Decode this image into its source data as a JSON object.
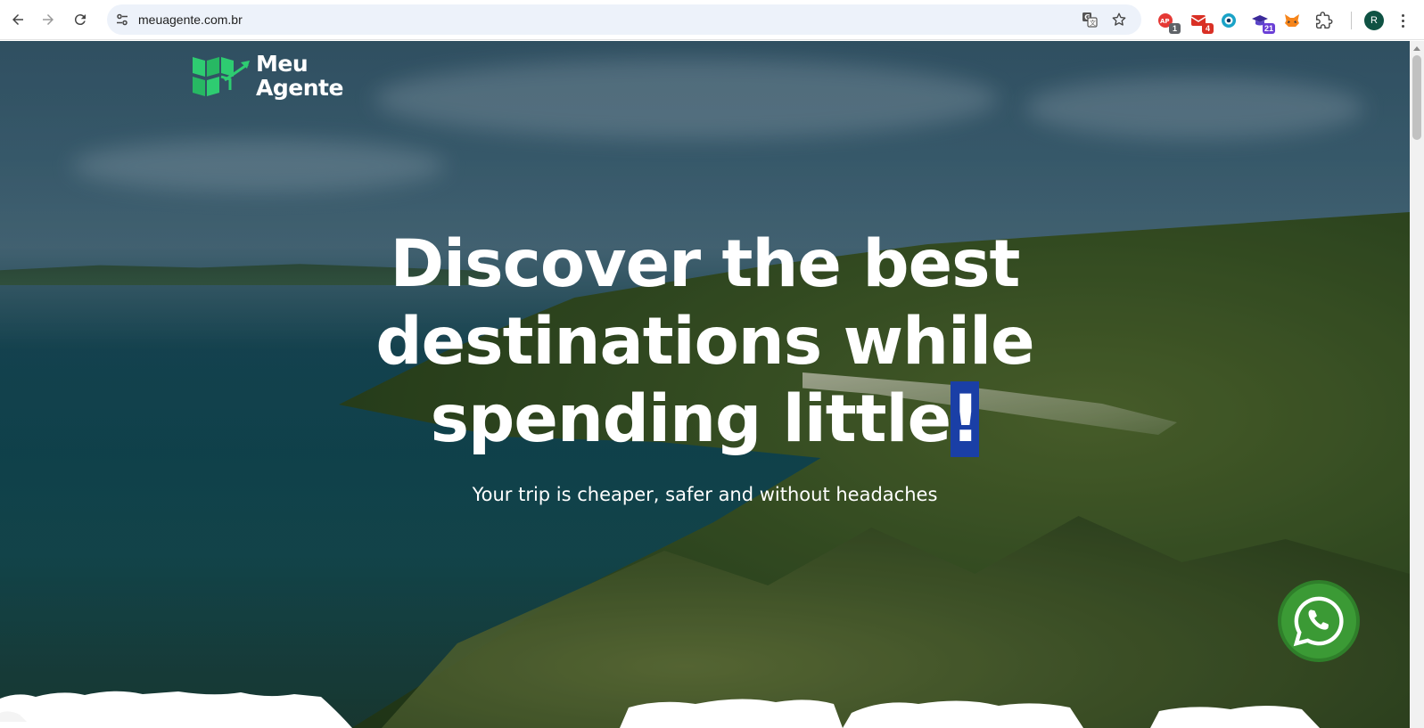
{
  "browser": {
    "url": "meuagente.com.br",
    "extensions": [
      {
        "name": "pdf-extension",
        "badge": "1",
        "badge_color": "#5f6368"
      },
      {
        "name": "mail-extension",
        "badge": "4",
        "badge_color": "#d93025"
      },
      {
        "name": "eye-extension",
        "badge": ""
      },
      {
        "name": "graduation-extension",
        "badge": "21",
        "badge_color": "#6a3fd6"
      },
      {
        "name": "fox-wallet-extension",
        "badge": ""
      }
    ],
    "profile_initial": "R"
  },
  "page": {
    "logo": {
      "line1": "Meu",
      "line2": "Agente",
      "accent_color": "#2ecc71"
    },
    "hero": {
      "headline_line1": "Discover the best",
      "headline_line2": "destinations while",
      "headline_line3_text": "spending little",
      "headline_line3_selected": "!",
      "subtitle": "Your trip is cheaper, safer and without headaches"
    },
    "whatsapp_color": "#3b9a35"
  }
}
